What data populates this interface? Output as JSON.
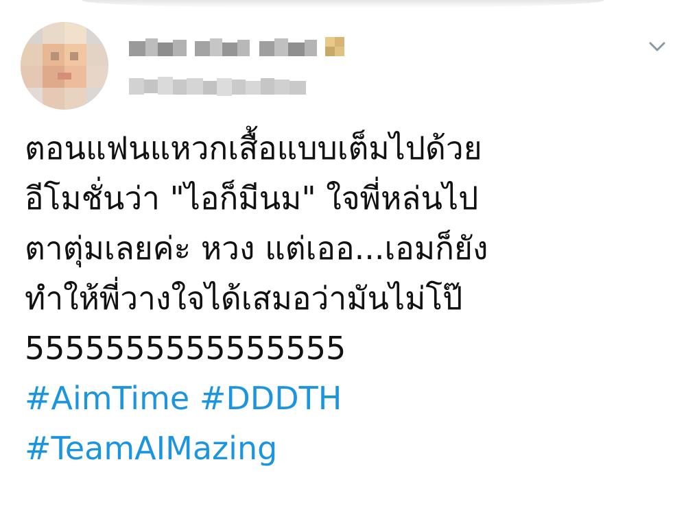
{
  "tweet": {
    "lines": [
      "ตอนแฟนแหวกเสื้อแบบเต็มไปด้วย",
      "อีโมชั่นว่า \"ไอก็มีนม\" ใจพี่หล่นไป",
      "ตาตุ่มเลยค่ะ หวง แต่เออ...เอมก็ยัง",
      "ทำให้พี่วางใจได้เสมอว่ามันไม่โป๊",
      "5555555555555555"
    ],
    "hashtags": [
      "#AimTime",
      "#DDDTH",
      "#TeamAIMazing"
    ]
  },
  "icons": {
    "avatar": "profile-photo-pixelated",
    "menu": "chevron-down-icon"
  },
  "colors": {
    "text": "#111111",
    "hashtag": "#1b95e0",
    "background": "#ffffff",
    "chevron": "#8899a6"
  }
}
